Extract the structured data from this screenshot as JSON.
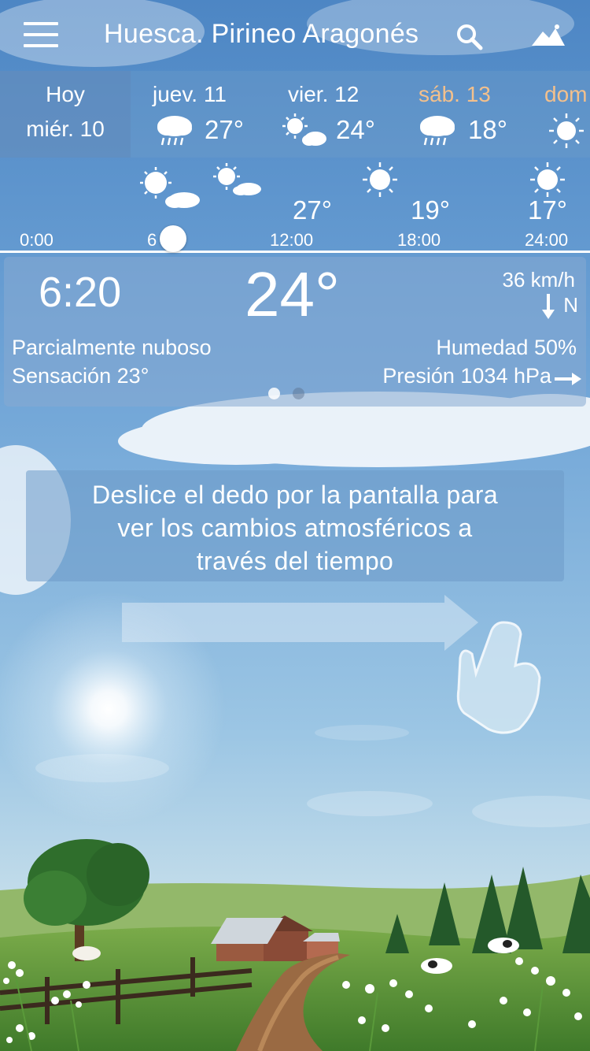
{
  "header": {
    "title": "Huesca. Pirineo Aragonés",
    "menu_icon": "hamburger-menu-icon",
    "search_icon": "search-icon",
    "scene_icon": "mountain-icon"
  },
  "days": [
    {
      "name": "Hoy",
      "sub": "miér. 10"
    },
    {
      "name": "juev. 11",
      "temp": "27°",
      "icon": "rain-cloud-icon"
    },
    {
      "name": "vier. 12",
      "temp": "24°",
      "icon": "sun-cloud-icon"
    },
    {
      "name": "sáb. 13",
      "temp": "18°",
      "icon": "rain-cloud-icon",
      "color": "#f3c08c"
    },
    {
      "name": "dom",
      "icon": "sun-icon",
      "color": "#f3c08c"
    }
  ],
  "timeline": {
    "temps": [
      "27°",
      "19°",
      "17°"
    ],
    "times": [
      "0:00",
      "6",
      "12:00",
      "18:00",
      "24:00"
    ],
    "slider_time": "6:20"
  },
  "current": {
    "time": "6:20",
    "temp": "24°",
    "wind": "36 km/h",
    "wind_dir": "N",
    "condition": "Parcialmente nuboso",
    "feels": "Sensación 23°",
    "humidity": "Humedad 50%",
    "pressure": "Presión 1034 hPa",
    "page_index": 1,
    "page_count": 2
  },
  "hint": {
    "line1": "Deslice el dedo por la pantalla para",
    "line2": "ver los cambios atmosféricos a",
    "line3": "través del tiempo"
  }
}
